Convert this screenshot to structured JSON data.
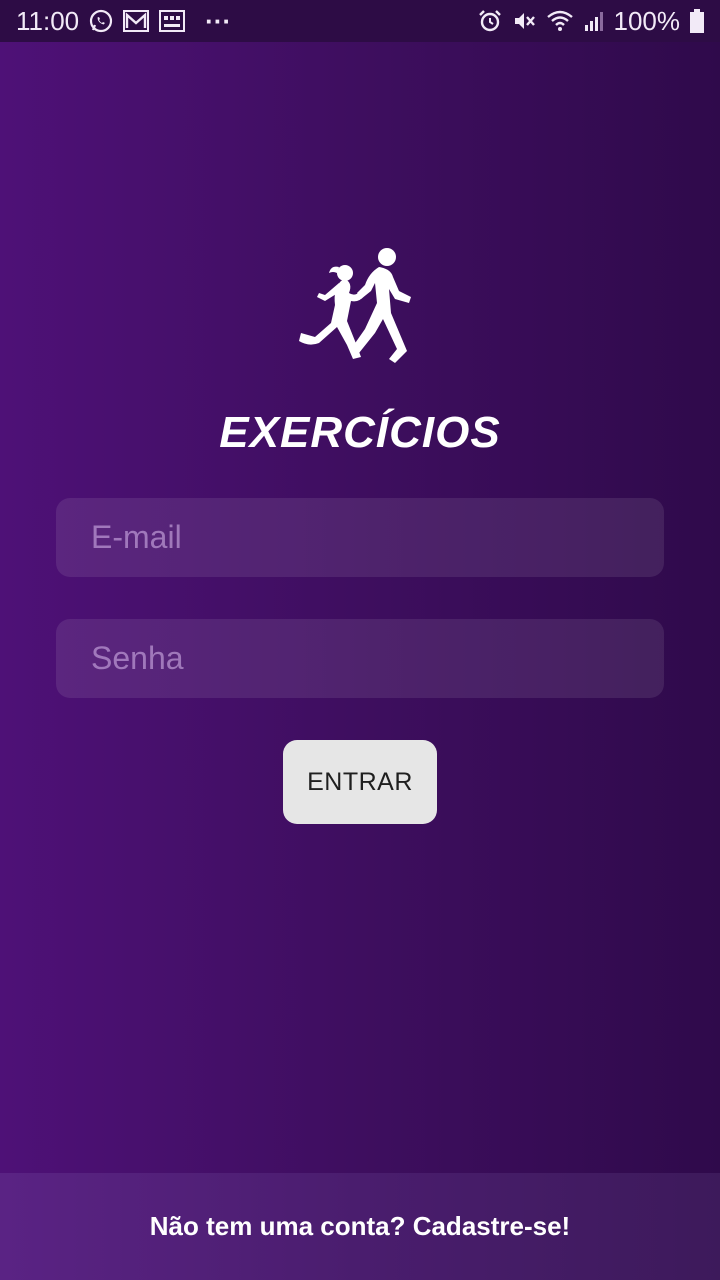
{
  "status_bar": {
    "time": "11:00",
    "overflow": "···",
    "battery": "100%",
    "icons_left": [
      "whatsapp-icon",
      "gmail-icon",
      "news-icon"
    ],
    "icons_right": [
      "alarm-icon",
      "mute-icon",
      "wifi-icon",
      "signal-icon",
      "battery-icon"
    ]
  },
  "logo": {
    "icon": "runners-icon",
    "title": "EXERCÍCIOS"
  },
  "login": {
    "email_placeholder": "E-mail",
    "email_value": "",
    "password_placeholder": "Senha",
    "password_value": "",
    "submit_label": "ENTRAR"
  },
  "signup": {
    "label": "Não tem uma conta? Cadastre-se!"
  },
  "colors": {
    "background_start": "#4e1177",
    "background_end": "#2f0a4b",
    "button_bg": "#e6e6e6"
  }
}
